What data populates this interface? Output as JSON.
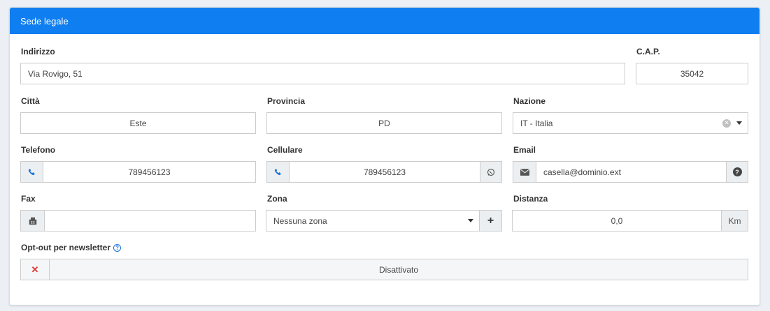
{
  "section_title": "Sede legale",
  "fields": {
    "indirizzo": {
      "label": "Indirizzo",
      "value": "Via Rovigo, 51"
    },
    "cap": {
      "label": "C.A.P.",
      "value": "35042"
    },
    "citta": {
      "label": "Città",
      "value": "Este"
    },
    "provincia": {
      "label": "Provincia",
      "value": "PD"
    },
    "nazione": {
      "label": "Nazione",
      "value": "IT - Italia"
    },
    "telefono": {
      "label": "Telefono",
      "value": "789456123"
    },
    "cellulare": {
      "label": "Cellulare",
      "value": "789456123"
    },
    "email": {
      "label": "Email",
      "placeholder": "casella@dominio.ext"
    },
    "fax": {
      "label": "Fax",
      "value": ""
    },
    "zona": {
      "label": "Zona",
      "placeholder": "Nessuna zona"
    },
    "distanza": {
      "label": "Distanza",
      "value": "0,0",
      "unit": "Km"
    },
    "newsletter": {
      "label": "Opt-out per newsletter",
      "status": "Disattivato"
    }
  },
  "icons": {
    "phone": "phone-icon",
    "whatsapp": "whatsapp-icon",
    "envelope": "envelope-icon",
    "help": "question-circle-icon",
    "fax": "fax-icon",
    "plus": "plus-icon",
    "close": "times-icon"
  },
  "colors": {
    "header": "#0f7ef0",
    "status_off": "#dd3030",
    "icon_blue": "#1a73d9"
  }
}
